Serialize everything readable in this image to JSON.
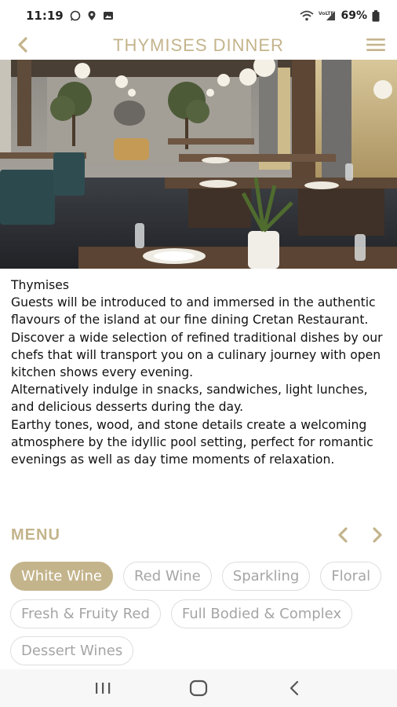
{
  "status_bar": {
    "time": "11:19",
    "battery": "69%",
    "icons": [
      "whatsapp-icon",
      "location-icon",
      "gallery-icon",
      "wifi-icon",
      "volte-signal-icon",
      "battery-icon"
    ]
  },
  "header": {
    "title": "THYMISES DINNER",
    "back_icon": "chevron-left-icon",
    "menu_icon": "hamburger-menu-icon"
  },
  "hero": {
    "image": "restaurant-interior-photo"
  },
  "description": {
    "lines": [
      "Thymises",
      "Guests will be introduced to and immersed in the authentic flavours of the island at our fine dining Cretan Restaurant. Discover a wide selection of refined traditional dishes by our chefs that will transport you on a culinary journey with open kitchen shows every evening.",
      "Alternatively indulge in snacks, sandwiches, light lunches, and delicious desserts during the day.",
      "Earthy tones, wood, and stone details create a welcoming atmosphere by the idyllic pool setting, perfect for romantic evenings as well as day time moments of relaxation."
    ]
  },
  "menu": {
    "title": "MENU",
    "prev_icon": "chevron-left-icon",
    "next_icon": "chevron-right-icon",
    "categories_row1": [
      "White Wine",
      "Red Wine",
      "Sparkling",
      "Floral"
    ],
    "categories_row2": [
      "Fresh & Fruity Red",
      "Full Bodied & Complex"
    ],
    "categories_row3": [
      "Dessert Wines"
    ],
    "selected": "White Wine"
  },
  "colors": {
    "accent": "#c4b48c",
    "chip_border": "#dedede",
    "chip_text": "#a5a5a5"
  },
  "nav_bar": {
    "icons": [
      "recent-apps-icon",
      "home-icon",
      "back-icon"
    ]
  }
}
